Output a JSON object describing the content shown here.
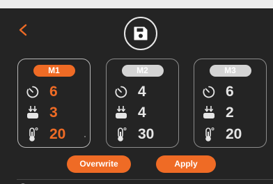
{
  "header": {
    "back_icon": "chevron-left-icon",
    "save_icon": "floppy-disk-icon"
  },
  "colors": {
    "accent": "#ef6b25",
    "background": "#242424",
    "text": "#e6e6e6",
    "inactive_badge": "#d4d4d4"
  },
  "memories": [
    {
      "label": "M1",
      "active": true,
      "speed": "6",
      "feed": "3",
      "temperature": "20"
    },
    {
      "label": "M2",
      "active": false,
      "speed": "4",
      "feed": "4",
      "temperature": "30"
    },
    {
      "label": "M3",
      "active": false,
      "speed": "6",
      "feed": "2",
      "temperature": "20"
    }
  ],
  "row_icons": [
    "speed-dial-icon",
    "feed-down-icon",
    "thermometer-icon"
  ],
  "actions": {
    "overwrite_label": "Overwrite",
    "apply_label": "Apply"
  },
  "footer": {
    "status_icon": "wifi-icon"
  }
}
